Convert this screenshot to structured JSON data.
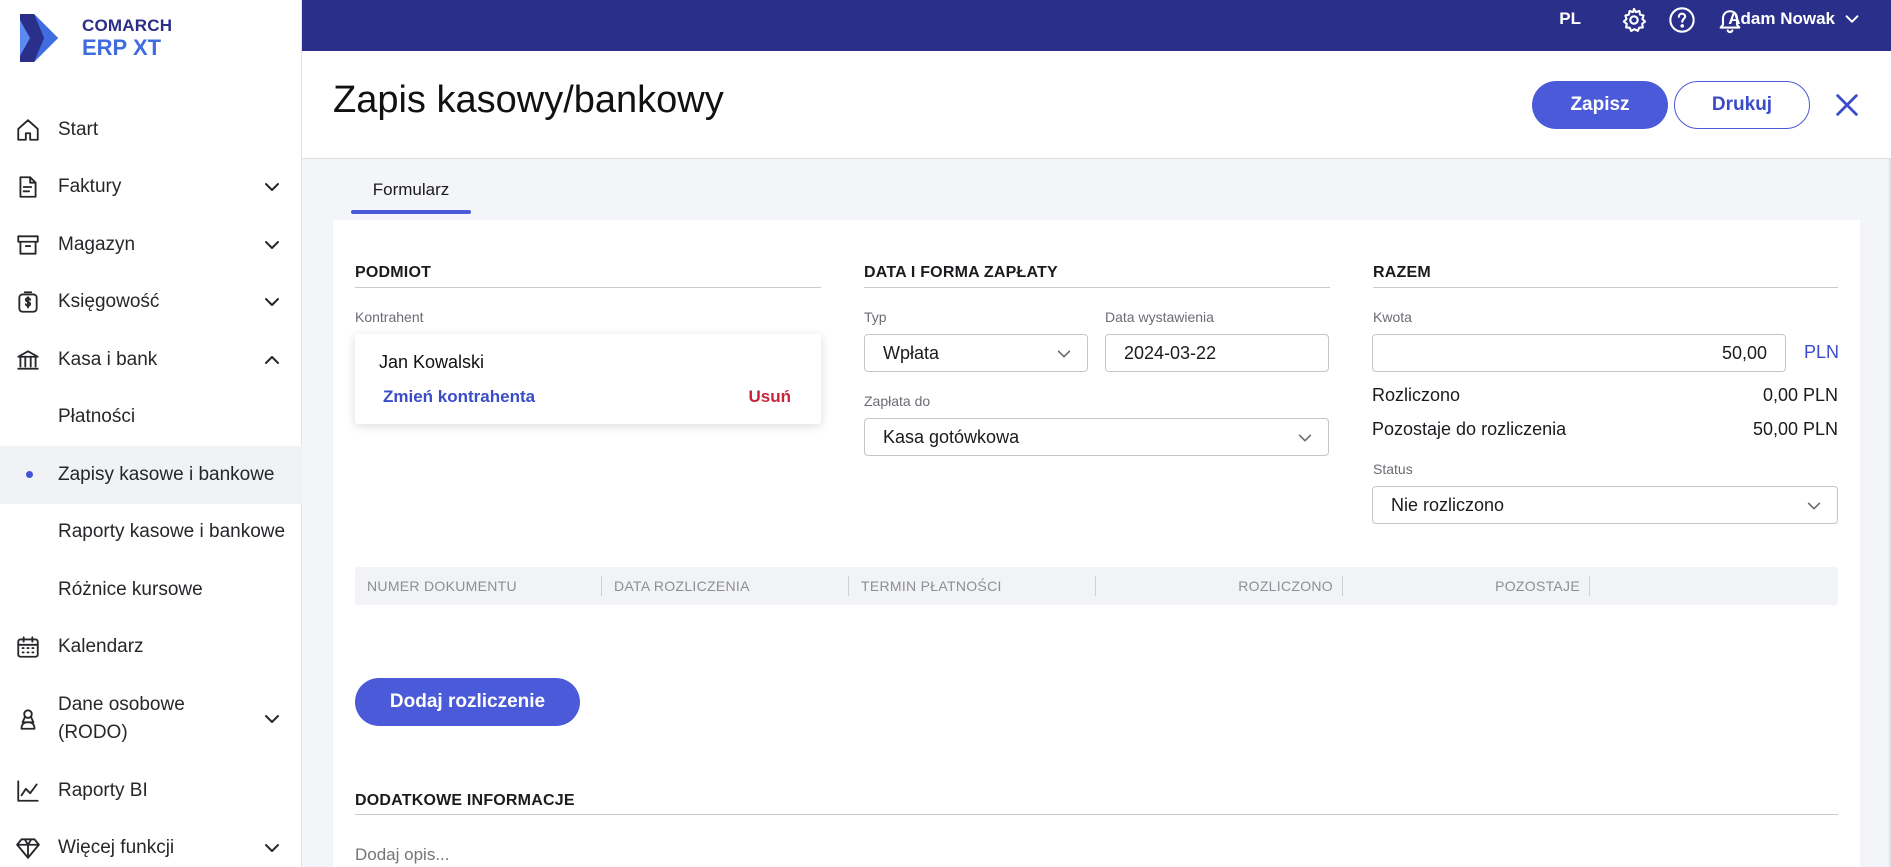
{
  "brand": {
    "line1": "COMARCH",
    "line2": "ERP XT"
  },
  "topbar": {
    "language": "PL",
    "user_name": "Adam Nowak"
  },
  "sidebar": {
    "items": [
      {
        "label": "Start",
        "icon": "home-icon"
      },
      {
        "label": "Faktury",
        "icon": "document-icon",
        "expandable": true
      },
      {
        "label": "Magazyn",
        "icon": "archive-box-icon",
        "expandable": true
      },
      {
        "label": "Księgowość",
        "icon": "accounting-icon",
        "expandable": true
      },
      {
        "label": "Kasa i bank",
        "icon": "bank-icon",
        "expanded": true
      },
      {
        "label": "Płatności",
        "sub": true
      },
      {
        "label": "Zapisy kasowe i bankowe",
        "sub": true,
        "active": true
      },
      {
        "label": "Raporty kasowe i bankowe",
        "sub": true
      },
      {
        "label": "Różnice kursowe",
        "sub": true
      },
      {
        "label": "Kalendarz",
        "icon": "calendar-icon"
      },
      {
        "label": "Dane osobowe (RODO)",
        "icon": "person-icon",
        "expandable": true
      },
      {
        "label": "Raporty BI",
        "icon": "chart-line-icon"
      },
      {
        "label": "Więcej funkcji",
        "icon": "diamond-icon",
        "expandable": true
      }
    ]
  },
  "header": {
    "title": "Zapis kasowy/bankowy",
    "save_label": "Zapisz",
    "print_label": "Drukuj"
  },
  "tabs": [
    {
      "label": "Formularz",
      "active": true
    }
  ],
  "subject": {
    "section_title": "PODMIOT",
    "contractor_label": "Kontrahent",
    "contractor_name": "Jan Kowalski",
    "change_label": "Zmień kontrahenta",
    "remove_label": "Usuń"
  },
  "payment": {
    "section_title": "DATA I FORMA ZAPŁATY",
    "type_label": "Typ",
    "type_value": "Wpłata",
    "issue_date_label": "Data wystawienia",
    "issue_date_value": "2024-03-22",
    "pay_to_label": "Zapłata do",
    "pay_to_value": "Kasa gotówkowa"
  },
  "totals": {
    "section_title": "RAZEM",
    "amount_label": "Kwota",
    "amount_value": "50,00",
    "currency": "PLN",
    "settled_label": "Rozliczono",
    "settled_value": "0,00 PLN",
    "remaining_label": "Pozostaje do rozliczenia",
    "remaining_value": "50,00 PLN",
    "status_label": "Status",
    "status_value": "Nie rozliczono"
  },
  "table": {
    "columns": [
      "NUMER DOKUMENTU",
      "DATA ROZLICZENIA",
      "TERMIN PŁATNOŚCI",
      "ROZLICZONO",
      "POZOSTAJE"
    ]
  },
  "add_settlement_label": "Dodaj rozliczenie",
  "additional": {
    "section_title": "DODATKOWE INFORMACJE",
    "description_placeholder": "Dodaj opis..."
  },
  "colors": {
    "accent": "#4a5ad9",
    "topbar": "#2a2f8a",
    "danger": "#c8243c"
  }
}
